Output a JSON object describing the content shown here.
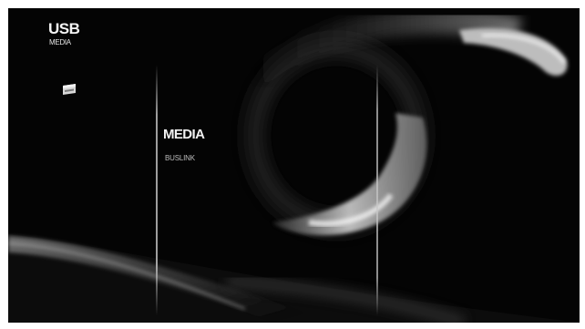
{
  "header": {
    "title": "USB",
    "subtitle": "MEDIA"
  },
  "source_icon": "usb-drive-icon",
  "menu": {
    "items": [
      {
        "label": "MEDIA",
        "sublabel": "BUSLINK",
        "selected": true
      }
    ]
  },
  "colors": {
    "background": "#040404",
    "text": "#f2f2f2",
    "subtext": "#bdbdbd"
  }
}
